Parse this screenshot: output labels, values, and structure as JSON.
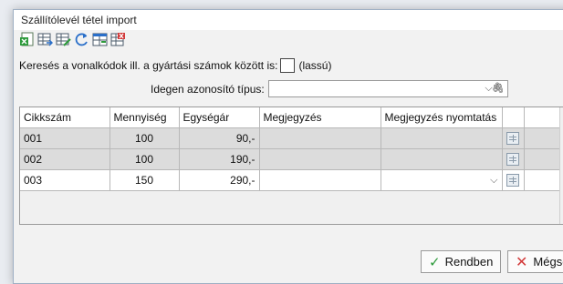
{
  "window": {
    "title": "Szállítólevél tétel import",
    "close": "×"
  },
  "toolbar": {
    "icons": [
      "excel-import-icon",
      "table-export-icon",
      "table-edit-icon",
      "refresh-icon",
      "column-layout-icon",
      "delete-table-icon"
    ],
    "colors": {
      "green": "#2c9a3a",
      "blue": "#2a6fc9",
      "red": "#d23a3a"
    }
  },
  "search": {
    "label": "Keresés a vonalkódok ill. a gyártási számok között is:",
    "suffix": "(lassú)",
    "checked": false
  },
  "foreign_id": {
    "label": "Idegen azonosító típus:",
    "value": "",
    "arrow": "⌵",
    "clip": "🖇"
  },
  "grid": {
    "columns": [
      "Cikkszám",
      "Mennyiség",
      "Egységár",
      "Megjegyzés",
      "Megjegyzés nyomtatás",
      ""
    ],
    "rows": [
      {
        "cikkszam": "001",
        "mennyiseg": "100",
        "egysegar": "90,-",
        "megjegyzes": "",
        "nyomtatas": ""
      },
      {
        "cikkszam": "002",
        "mennyiseg": "100",
        "egysegar": "190,-",
        "megjegyzes": "",
        "nyomtatas": ""
      },
      {
        "cikkszam": "003",
        "mennyiseg": "150",
        "egysegar": "290,-",
        "megjegyzes": "",
        "nyomtatas": "⌵"
      }
    ]
  },
  "buttons": {
    "ok": "Rendben",
    "cancel": "Mégse",
    "ok_icon": "✓",
    "cancel_icon": "✕"
  }
}
